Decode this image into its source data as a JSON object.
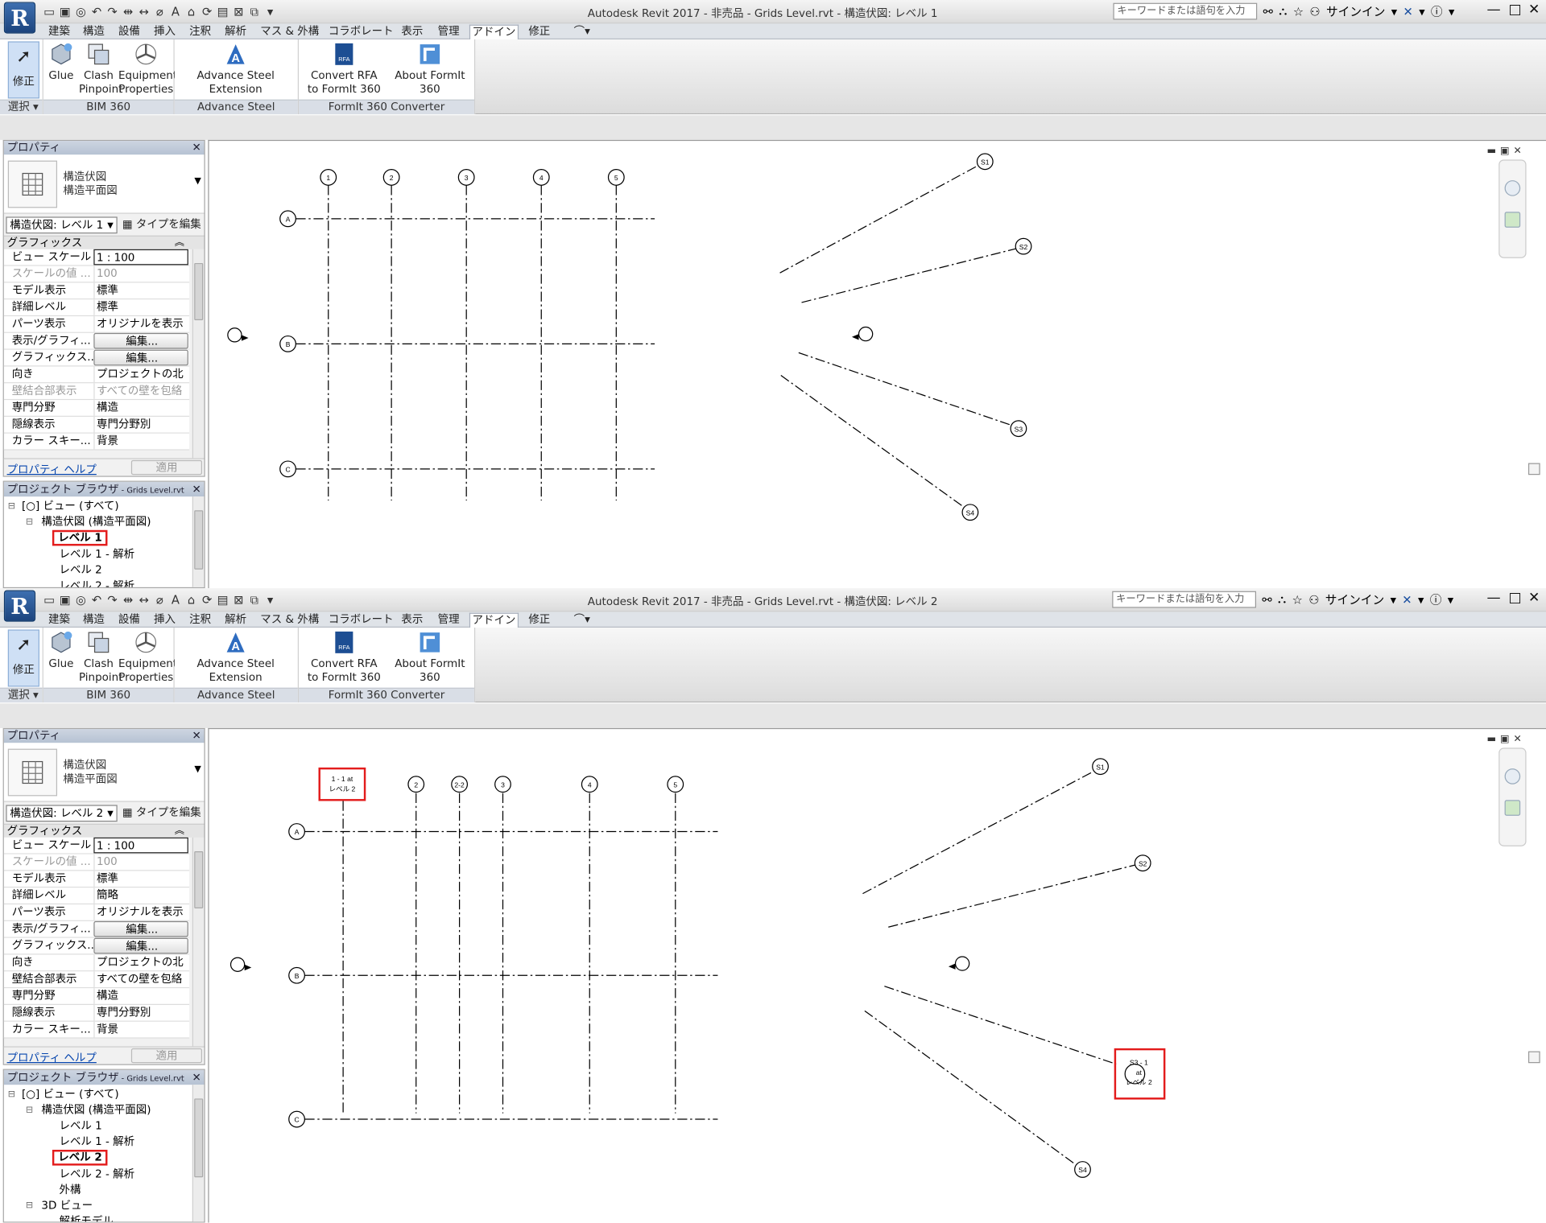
{
  "titlebar": {
    "search_placeholder": "キーワードまたは語句を入力",
    "sign_in": "サインイン",
    "app_letter": "R"
  },
  "tabs": [
    "建築",
    "構造",
    "設備",
    "挿入",
    "注釈",
    "解析",
    "マス & 外構",
    "コラボレート",
    "表示",
    "管理",
    "アドイン",
    "修正"
  ],
  "ribbon": {
    "modify": "修正",
    "select": "選択",
    "glue": "Glue",
    "clash1": "Clash",
    "clash2": "Pinpoint",
    "equip1": "Equipment",
    "equip2": "Properties",
    "adv1": "Advance Steel",
    "adv2": "Extension",
    "conv1": "Convert RFA",
    "conv2": "to FormIt 360",
    "about": "About FormIt 360",
    "panel_bim": "BIM 360",
    "panel_adv": "Advance Steel Extension",
    "panel_formit": "FormIt 360 Converter"
  },
  "props": {
    "header": "プロパティ",
    "type1": "構造伏図",
    "type2": "構造平面図",
    "edit_type": "タイプを編集",
    "group_graphics": "グラフィックス",
    "footer_link": "プロパティ ヘルプ",
    "apply": "適用"
  },
  "browser": {
    "header": "プロジェクト ブラウザ",
    "file": " - Grids Level.rvt",
    "views_all": "ビュー (すべて)",
    "struct_plans": "構造伏図 (構造平面図)",
    "level1": "レベル 1",
    "level1a": "レベル 1 - 解析",
    "level2": "レベル 2",
    "level2a": "レベル 2 - 解析",
    "exterior": "外構",
    "view3d": "3D ビュー",
    "analytic_model": "解析モデル"
  },
  "top": {
    "title": "Autodesk Revit 2017 - 非売品 -    Grids Level.rvt - 構造伏図: レベル 1",
    "type_selector": "構造伏図: レベル 1",
    "rows": [
      {
        "name": "ビュー スケール",
        "value": "1 : 100",
        "style": "input"
      },
      {
        "name": "スケールの値    ...",
        "value": "100",
        "style": "dim"
      },
      {
        "name": "モデル表示",
        "value": "標準",
        "style": ""
      },
      {
        "name": "詳細レベル",
        "value": "標準",
        "style": ""
      },
      {
        "name": "パーツ表示",
        "value": "オリジナルを表示",
        "style": ""
      },
      {
        "name": "表示/グラフィ...",
        "value": "編集...",
        "style": "btn"
      },
      {
        "name": "グラフィックス...",
        "value": "編集...",
        "style": "btn"
      },
      {
        "name": "向き",
        "value": "プロジェクトの北",
        "style": ""
      },
      {
        "name": "壁結合部表示",
        "value": "すべての壁を包絡",
        "style": "dim"
      },
      {
        "name": "専門分野",
        "value": "構造",
        "style": ""
      },
      {
        "name": "隠線表示",
        "value": "専門分野別",
        "style": ""
      },
      {
        "name": "カラー スキー...",
        "value": "背景",
        "style": ""
      }
    ],
    "grid_cols": [
      "1",
      "2",
      "3",
      "4",
      "5"
    ],
    "grid_rows": [
      "A",
      "B",
      "C"
    ],
    "radial": [
      "S1",
      "S2",
      "S3",
      "S4"
    ]
  },
  "bottom": {
    "title": "Autodesk Revit 2017 - 非売品 -    Grids Level.rvt - 構造伏図: レベル 2",
    "type_selector": "構造伏図: レベル 2",
    "rows": [
      {
        "name": "ビュー スケール",
        "value": "1 : 100",
        "style": "input"
      },
      {
        "name": "スケールの値    ...",
        "value": "100",
        "style": "dim"
      },
      {
        "name": "モデル表示",
        "value": "標準",
        "style": ""
      },
      {
        "name": "詳細レベル",
        "value": "簡略",
        "style": ""
      },
      {
        "name": "パーツ表示",
        "value": "オリジナルを表示",
        "style": ""
      },
      {
        "name": "表示/グラフィ...",
        "value": "編集...",
        "style": "btn"
      },
      {
        "name": "グラフィックス...",
        "value": "編集...",
        "style": "btn"
      },
      {
        "name": "向き",
        "value": "プロジェクトの北",
        "style": ""
      },
      {
        "name": "壁結合部表示",
        "value": "すべての壁を包絡",
        "style": ""
      },
      {
        "name": "専門分野",
        "value": "構造",
        "style": ""
      },
      {
        "name": "隠線表示",
        "value": "専門分野別",
        "style": ""
      },
      {
        "name": "カラー スキー...",
        "value": "背景",
        "style": ""
      }
    ],
    "grid_cols": [
      "2",
      "2-2",
      "3",
      "4",
      "5"
    ],
    "grid_rows": [
      "A",
      "B",
      "C"
    ],
    "radial": [
      "S1",
      "S2",
      "S4"
    ],
    "callout_line1": "1 - 1 at",
    "callout_line2": "レベル 2",
    "s3_line1": "S3 - 1",
    "s3_line2": "at",
    "s3_line3": "レベル 2"
  },
  "colors": {
    "highlight": "#e31c1c",
    "ribbon_blue": "#cfe0f5"
  }
}
